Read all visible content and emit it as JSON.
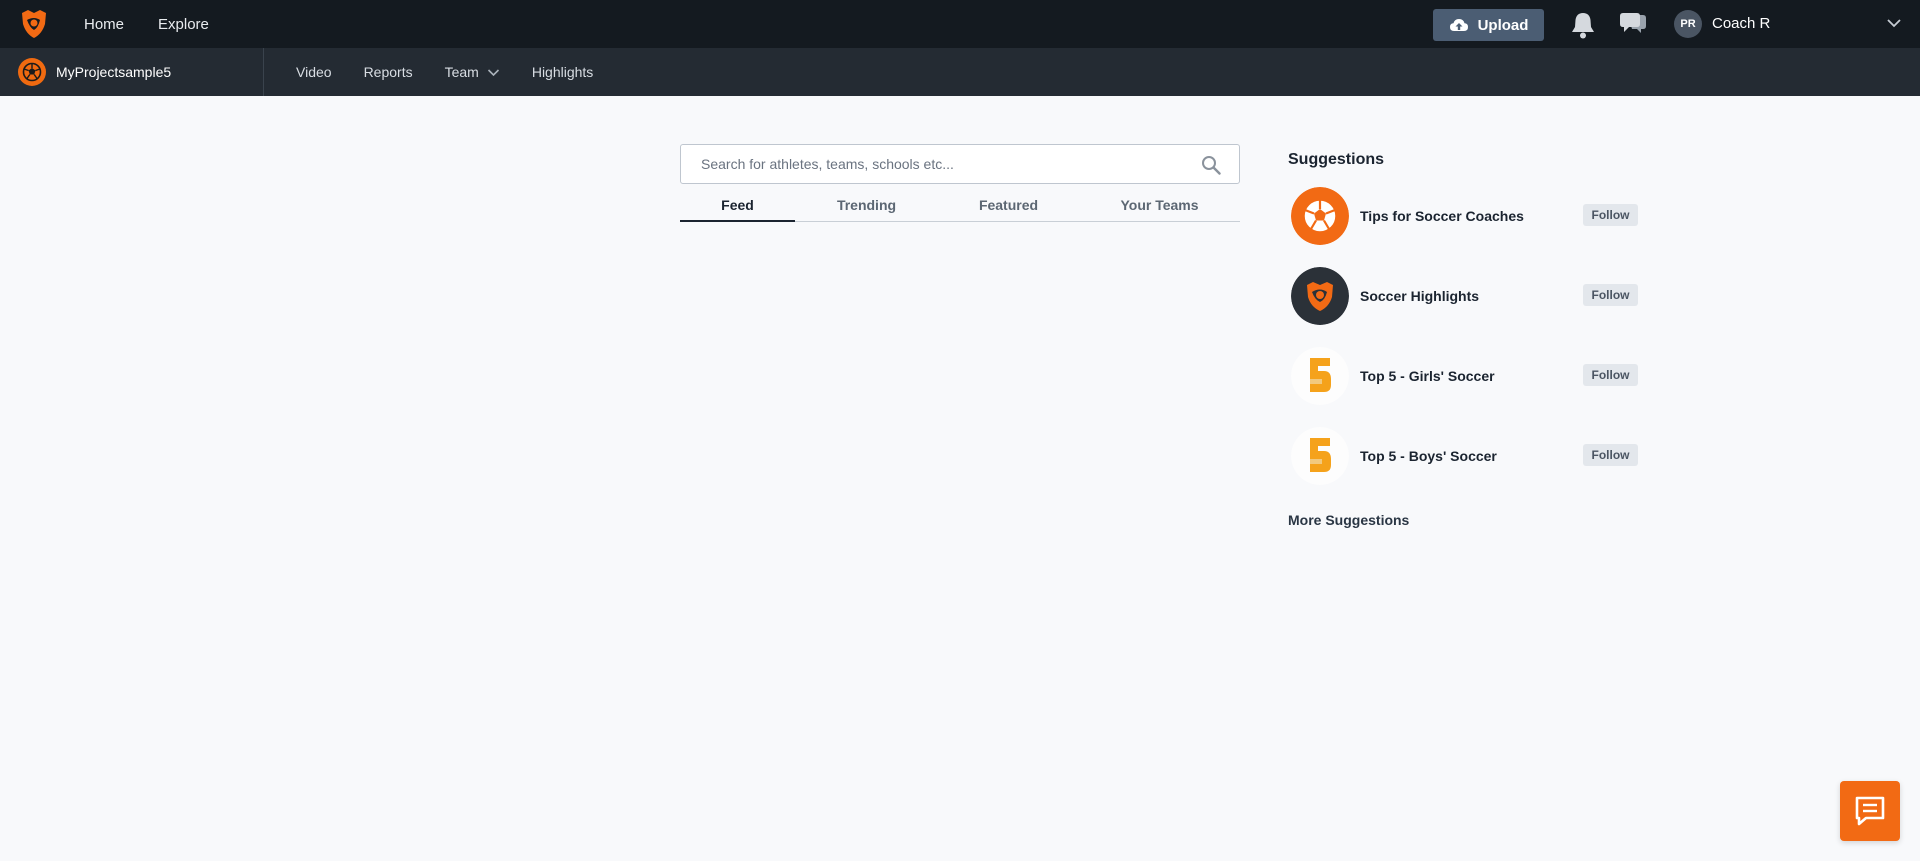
{
  "colors": {
    "accent": "#f26a14",
    "topbar_bg": "#141a20",
    "subbar_bg": "#242b33",
    "upload_bg": "#4b5d73",
    "page_bg": "#f8f9fb"
  },
  "topbar": {
    "nav": [
      {
        "label": "Home"
      },
      {
        "label": "Explore"
      }
    ],
    "upload_label": "Upload",
    "user_initials": "PR",
    "user_name": "Coach R",
    "icons": [
      "logo",
      "upload-cloud-icon",
      "bell-icon",
      "chat-bubbles-icon",
      "chevron-down-icon"
    ]
  },
  "subbar": {
    "team_name": "MyProjectsample5",
    "nav": [
      {
        "label": "Video"
      },
      {
        "label": "Reports"
      },
      {
        "label": "Team"
      },
      {
        "label": "Highlights"
      }
    ]
  },
  "search": {
    "placeholder": "Search for athletes, teams, schools etc..."
  },
  "tabs": [
    {
      "label": "Feed",
      "active": true
    },
    {
      "label": "Trending",
      "active": false
    },
    {
      "label": "Featured",
      "active": false
    },
    {
      "label": "Your Teams",
      "active": false
    }
  ],
  "suggestions": {
    "title": "Suggestions",
    "items": [
      {
        "name": "Tips for Soccer Coaches",
        "follow_label": "Follow",
        "icon": "soccer-ball-icon"
      },
      {
        "name": "Soccer Highlights",
        "follow_label": "Follow",
        "icon": "hudl-logo-icon"
      },
      {
        "name": "Top 5 - Girls' Soccer",
        "follow_label": "Follow",
        "icon": "top-5-icon"
      },
      {
        "name": "Top 5 - Boys' Soccer",
        "follow_label": "Follow",
        "icon": "top-5-icon"
      }
    ],
    "more_label": "More Suggestions"
  }
}
